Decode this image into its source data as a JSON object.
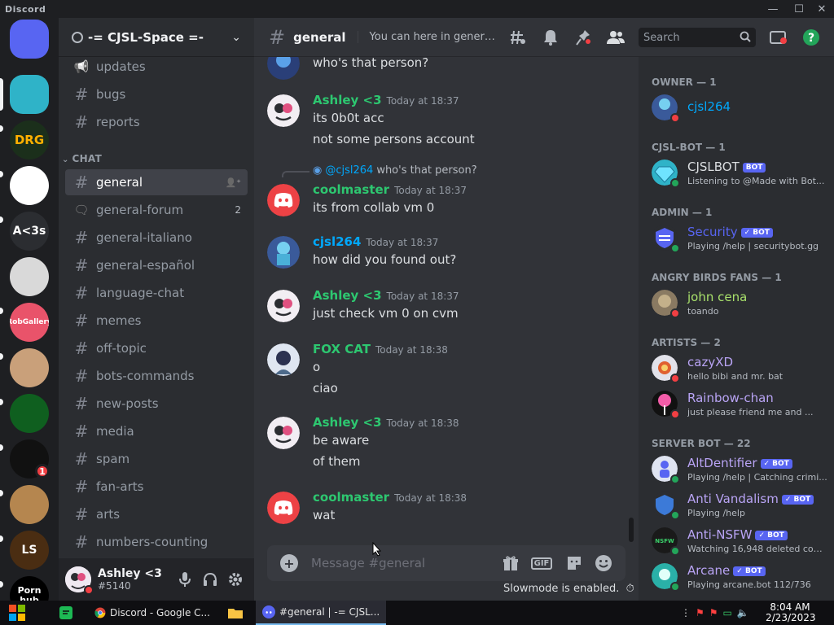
{
  "app": {
    "title": "Discord"
  },
  "guild": {
    "name": "-= CJSL-Space =-"
  },
  "servers": [
    {
      "label": "",
      "color": "#5865f2"
    },
    {
      "label": "",
      "color": "#2fb3c8"
    },
    {
      "label": "DRG",
      "color": "#1b2f1b"
    },
    {
      "label": "",
      "color": "#ffffff"
    },
    {
      "label": "A<3s",
      "color": "#2b2d31"
    },
    {
      "label": "",
      "color": "#d9d9d9"
    },
    {
      "label": "RobGallery",
      "color": "#e9536a"
    },
    {
      "label": "",
      "color": "#c9a07a"
    },
    {
      "label": "",
      "color": "#0f5f1f"
    },
    {
      "label": "",
      "color": "#111111"
    },
    {
      "label": "",
      "color": "#b5864f"
    },
    {
      "label": "LS",
      "color": "#4a2d12"
    },
    {
      "label": "Porn hub",
      "color": "#000000"
    }
  ],
  "server_mentions": {
    "badge": "1"
  },
  "channels": [
    {
      "name": "updates",
      "icon": "megaphone"
    },
    {
      "name": "bugs",
      "icon": "hash"
    },
    {
      "name": "reports",
      "icon": "hash"
    },
    {
      "name": "general",
      "icon": "hash",
      "active": true
    },
    {
      "name": "general-forum",
      "icon": "forum",
      "count": "2"
    },
    {
      "name": "general-italiano",
      "icon": "hash"
    },
    {
      "name": "general-español",
      "icon": "hash"
    },
    {
      "name": "language-chat",
      "icon": "hash"
    },
    {
      "name": "memes",
      "icon": "hash"
    },
    {
      "name": "off-topic",
      "icon": "hash"
    },
    {
      "name": "bots-commands",
      "icon": "hash"
    },
    {
      "name": "new-posts",
      "icon": "hash"
    },
    {
      "name": "media",
      "icon": "hash"
    },
    {
      "name": "spam",
      "icon": "hash"
    },
    {
      "name": "fan-arts",
      "icon": "hash"
    },
    {
      "name": "arts",
      "icon": "hash"
    },
    {
      "name": "numbers-counting",
      "icon": "hash"
    }
  ],
  "category": {
    "chat": "CHAT"
  },
  "user": {
    "name": "Ashley <3",
    "tag": "#5140"
  },
  "header": {
    "channel": "general",
    "topic": "You can here in general (N...",
    "search_placeholder": "Search"
  },
  "messages": [
    {
      "author": "",
      "time": "",
      "lines": [
        "who's that person?"
      ],
      "color": "#00a8fc",
      "continuation": true
    },
    {
      "author": "Ashley <3",
      "time": "Today at 18:37",
      "lines": [
        "its 0b0t acc",
        "not some persons account"
      ],
      "color": "#2dc770"
    },
    {
      "author": "coolmaster",
      "time": "Today at 18:37",
      "lines": [
        "its from collab vm 0"
      ],
      "color": "#2dc770",
      "reply": {
        "author": "@cjsl264",
        "text": "who's that person?"
      }
    },
    {
      "author": "cjsl264",
      "time": "Today at 18:37",
      "lines": [
        "how did you found out?"
      ],
      "color": "#00a8fc"
    },
    {
      "author": "Ashley <3",
      "time": "Today at 18:37",
      "lines": [
        "just check vm 0 on cvm"
      ],
      "color": "#2dc770"
    },
    {
      "author": "FOX CAT",
      "time": "Today at 18:38",
      "lines": [
        "o",
        "ciao"
      ],
      "color": "#2dc770"
    },
    {
      "author": "Ashley <3",
      "time": "Today at 18:38",
      "lines": [
        "be aware",
        "of them"
      ],
      "color": "#2dc770"
    },
    {
      "author": "coolmaster",
      "time": "Today at 18:38",
      "lines": [
        "wat"
      ],
      "color": "#2dc770"
    }
  ],
  "composer": {
    "placeholder": "Message #general",
    "gif_label": "GIF",
    "slowmode": "Slowmode is enabled."
  },
  "member_groups": [
    {
      "title": "OWNER — 1",
      "members": [
        {
          "name": "cjsl264",
          "color": "#00a8fc",
          "status": "dnd"
        }
      ]
    },
    {
      "title": "CJSL-BOT — 1",
      "members": [
        {
          "name": "CJSLBOT",
          "color": "#dbdee1",
          "bot": "BOT",
          "activity": "Listening to @Made with Bot...",
          "status": "online"
        }
      ]
    },
    {
      "title": "ADMIN — 1",
      "members": [
        {
          "name": "Security",
          "color": "#5865f2",
          "bot": "✓ BOT",
          "activity": "Playing /help | securitybot.gg",
          "status": "online"
        }
      ]
    },
    {
      "title": "ANGRY BIRDS FANS — 1",
      "members": [
        {
          "name": "john cena",
          "color": "#a8e06b",
          "activity": "toando",
          "status": "dnd"
        }
      ]
    },
    {
      "title": "ARTISTS — 2",
      "members": [
        {
          "name": "cazyXD",
          "color": "#b9a4f5",
          "activity": "hello bibi and mr. bat",
          "status": "dnd"
        },
        {
          "name": "Rainbow-chan",
          "color": "#b9a4f5",
          "activity": "just please friend me and ...",
          "status": "dnd"
        }
      ]
    },
    {
      "title": "SERVER BOT — 22",
      "members": [
        {
          "name": "AltDentifier",
          "color": "#b9a4f5",
          "bot": "✓ BOT",
          "activity": "Playing /help | Catching crimi...",
          "status": "online"
        },
        {
          "name": "Anti Vandalism",
          "color": "#b9a4f5",
          "bot": "✓ BOT",
          "activity": "Playing /help",
          "status": "online"
        },
        {
          "name": "Anti-NSFW",
          "color": "#b9a4f5",
          "bot": "✓ BOT",
          "activity": "Watching 16,948 deleted cont...",
          "status": "online"
        },
        {
          "name": "Arcane",
          "color": "#b9a4f5",
          "bot": "✓ BOT",
          "activity": "Playing arcane.bot 112/736",
          "status": "online"
        }
      ]
    }
  ],
  "taskbar": {
    "items": [
      "Discord - Google C...",
      "#general | -= CJSL..."
    ],
    "time": "8:04 AM",
    "date": "2/23/2023"
  }
}
